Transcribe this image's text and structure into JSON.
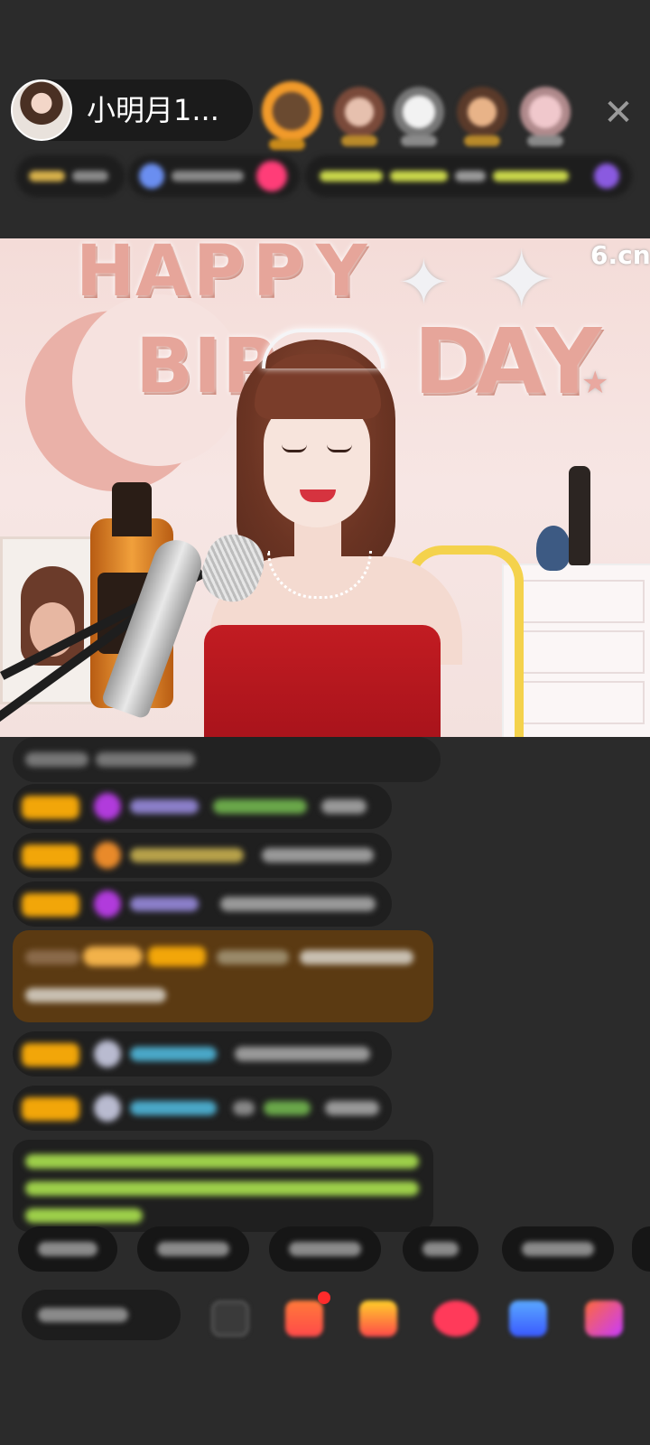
{
  "header": {
    "host_name": "小明月1...",
    "close_glyph": "✕"
  },
  "video": {
    "watermark": "6.cn",
    "decor_letters": [
      "H",
      "A",
      "P",
      "P",
      "Y",
      "B",
      "I",
      "R",
      "D",
      "A",
      "Y"
    ]
  },
  "colors": {
    "background": "#2b2b2b",
    "badge_gold": "#f2a609",
    "chat_bubble": "#1f1f1f",
    "highlight_card": "#5b3a12",
    "system_text_green": "#9ed04a",
    "dress_red": "#c21c22",
    "notification_dot": "#ff2b2b"
  },
  "icons": {
    "close": "close-icon",
    "emoji": "emoji-icon",
    "gift": "gift-icon",
    "treasure": "treasure-icon",
    "heart": "heart-icon",
    "game": "game-icon",
    "grid": "grid-icon"
  }
}
